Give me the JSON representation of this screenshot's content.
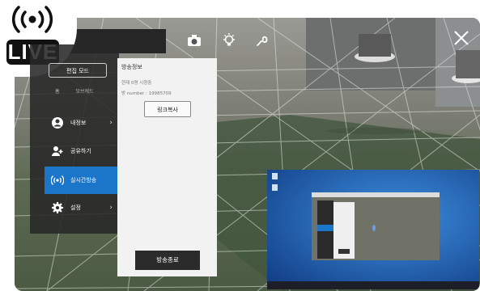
{
  "badge": {
    "text": "LIVE"
  },
  "toolbar": {
    "icons": [
      "camera-icon",
      "light-icon",
      "path-icon"
    ],
    "close_icon": "close-icon"
  },
  "sidebar": {
    "edit_mode_label": "편집 모드",
    "tabs": [
      "홈",
      "모브캐드"
    ],
    "items": [
      {
        "label": "내정보",
        "icon": "profile-icon",
        "active": false,
        "chevron": true
      },
      {
        "label": "공유하기",
        "icon": "share-icon",
        "active": false,
        "chevron": false
      },
      {
        "label": "실시간방송",
        "icon": "broadcast-icon",
        "active": true,
        "chevron": false
      },
      {
        "label": "설정",
        "icon": "settings-icon",
        "active": false,
        "chevron": true
      }
    ],
    "chevron": "›"
  },
  "panel": {
    "title": "방송정보",
    "line1": "현재 0명 시청중",
    "line2": "방 number : 19985709",
    "link_button": "링크복사",
    "end_button": "방송종료"
  },
  "colors": {
    "accent": "#1b75c8",
    "sidebar_bg": "#282828",
    "panel_bg": "#f2f2f2"
  }
}
